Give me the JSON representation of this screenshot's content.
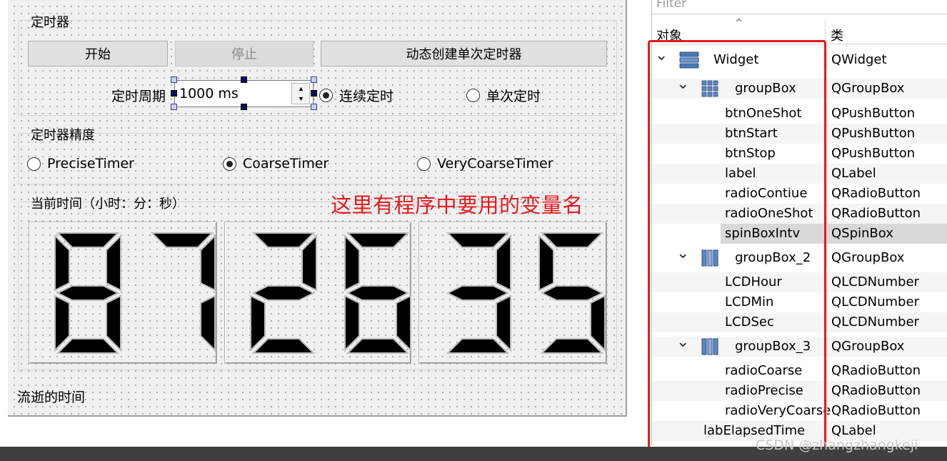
{
  "form": {
    "group_timer": {
      "title": "定时器",
      "btn_start": "开始",
      "btn_stop": "停止",
      "btn_oneshot": "动态创建单次定时器",
      "period_label": "定时周期",
      "spin_value": "1000 ms",
      "radio_continuous": "连续定时",
      "radio_oneshot": "单次定时"
    },
    "group_precision": {
      "title": "定时器精度",
      "radio_precise": "PreciseTimer",
      "radio_coarse": "CoarseTimer",
      "radio_verycoarse": "VeryCoarseTimer"
    },
    "group_time": {
      "title": "当前时间（小时：分：秒）",
      "hour": "87",
      "minute": "26",
      "second": "35"
    },
    "elapsed_label": "流逝的时间"
  },
  "annotation": "这里有程序中要用的变量名",
  "inspector": {
    "filter_placeholder": "Filter",
    "col_object": "对象",
    "col_class": "类",
    "rows": [
      {
        "name": "Widget",
        "class": "QWidget"
      },
      {
        "name": "groupBox",
        "class": "QGroupBox"
      },
      {
        "name": "btnOneShot",
        "class": "QPushButton"
      },
      {
        "name": "btnStart",
        "class": "QPushButton"
      },
      {
        "name": "btnStop",
        "class": "QPushButton"
      },
      {
        "name": "label",
        "class": "QLabel"
      },
      {
        "name": "radioContiue",
        "class": "QRadioButton"
      },
      {
        "name": "radioOneShot",
        "class": "QRadioButton"
      },
      {
        "name": "spinBoxIntv",
        "class": "QSpinBox"
      },
      {
        "name": "groupBox_2",
        "class": "QGroupBox"
      },
      {
        "name": "LCDHour",
        "class": "QLCDNumber"
      },
      {
        "name": "LCDMin",
        "class": "QLCDNumber"
      },
      {
        "name": "LCDSec",
        "class": "QLCDNumber"
      },
      {
        "name": "groupBox_3",
        "class": "QGroupBox"
      },
      {
        "name": "radioCoarse",
        "class": "QRadioButton"
      },
      {
        "name": "radioPrecise",
        "class": "QRadioButton"
      },
      {
        "name": "radioVeryCoarse",
        "class": "QRadioButton"
      },
      {
        "name": "labElapsedTime",
        "class": "QLabel"
      }
    ]
  },
  "watermark": "CSDN @zhangzhangkeji",
  "colors": {
    "annotation_red": "#e8191c",
    "lcd_fill": "#000000",
    "lcd_outline": "#bdbdbd"
  }
}
